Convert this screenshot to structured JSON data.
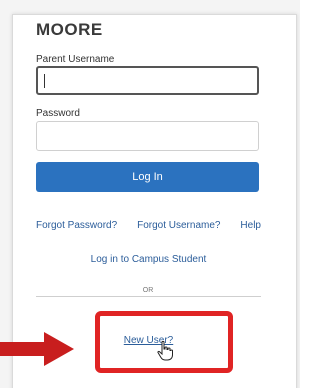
{
  "login": {
    "district_name": "MOORE",
    "username_label": "Parent Username",
    "username_value": "",
    "password_label": "Password",
    "password_value": "",
    "login_button": "Log In"
  },
  "links": {
    "forgot_password": "Forgot Password?",
    "forgot_username": "Forgot Username?",
    "help": "Help",
    "campus_student": "Log in to Campus Student",
    "or_text": "OR",
    "new_user": "New User?"
  },
  "annotation": {
    "arrow_color": "#c81e1e",
    "highlight_color": "#e02424",
    "icons": [
      "arrow-right-icon",
      "hand-pointer-icon"
    ]
  },
  "colors": {
    "button": "#2b72bf",
    "link": "#2b5d9a"
  }
}
